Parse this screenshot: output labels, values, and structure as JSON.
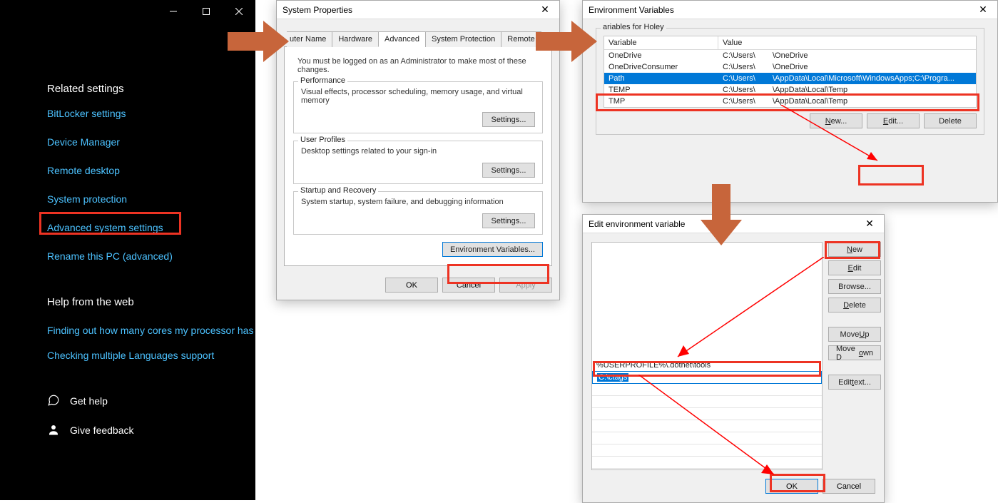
{
  "settings": {
    "related_heading": "Related settings",
    "links": {
      "bitlocker": "BitLocker settings",
      "devmgr": "Device Manager",
      "rdesktop": "Remote desktop",
      "sysprotect": "System protection",
      "advsys": "Advanced system settings",
      "rename": "Rename this PC (advanced)"
    },
    "help_heading": "Help from the web",
    "help_links": {
      "cores": "Finding out how many cores my processor has",
      "langs": "Checking multiple Languages support"
    },
    "get_help": "Get help",
    "feedback": "Give feedback"
  },
  "sysprop": {
    "title": "System Properties",
    "tabs": {
      "computer_name": "uter Name",
      "hardware": "Hardware",
      "advanced": "Advanced",
      "sysprotect": "System Protection",
      "remote": "Remote"
    },
    "admin_note": "You must be logged on as an Administrator to make most of these changes.",
    "perf": {
      "title": "Performance",
      "text": "Visual effects, processor scheduling, memory usage, and virtual memory",
      "btn": "Settings..."
    },
    "profiles": {
      "title": "User Profiles",
      "text": "Desktop settings related to your sign-in",
      "btn": "Settings..."
    },
    "startup": {
      "title": "Startup and Recovery",
      "text": "System startup, system failure, and debugging information",
      "btn": "Settings..."
    },
    "envvar_btn": "Environment Variables...",
    "ok": "OK",
    "cancel": "Cancel",
    "apply": "Apply"
  },
  "envvars": {
    "title": "Environment Variables",
    "group_title_prefix": "ariables for Holey",
    "col_var": "Variable",
    "col_val": "Value",
    "rows": [
      {
        "var": "OneDrive",
        "v1": "C:\\Users\\",
        "v2": "\\OneDrive",
        "sel": false
      },
      {
        "var": "OneDriveConsumer",
        "v1": "C:\\Users\\",
        "v2": "\\OneDrive",
        "sel": false
      },
      {
        "var": "Path",
        "v1": "C:\\Users\\",
        "v2": "\\AppData\\Local\\Microsoft\\WindowsApps;C:\\Progra...",
        "sel": true
      },
      {
        "var": "TEMP",
        "v1": "C:\\Users\\",
        "v2": "\\AppData\\Local\\Temp",
        "sel": false
      },
      {
        "var": "TMP",
        "v1": "C:\\Users\\",
        "v2": "\\AppData\\Local\\Temp",
        "sel": false
      }
    ],
    "new": "New...",
    "edit": "Edit...",
    "delete": "Delete"
  },
  "editev": {
    "title": "Edit environment variable",
    "rows": {
      "userprofile": "%USERPROFILE%\\.dotnet\\tools",
      "ctags": "C:\\ctags"
    },
    "btns": {
      "new": "New",
      "edit": "Edit",
      "browse": "Browse...",
      "delete": "Delete",
      "moveup": "Move Up",
      "movedown": "Move Down",
      "edittext": "Edit text..."
    },
    "ok": "OK",
    "cancel": "Cancel"
  }
}
